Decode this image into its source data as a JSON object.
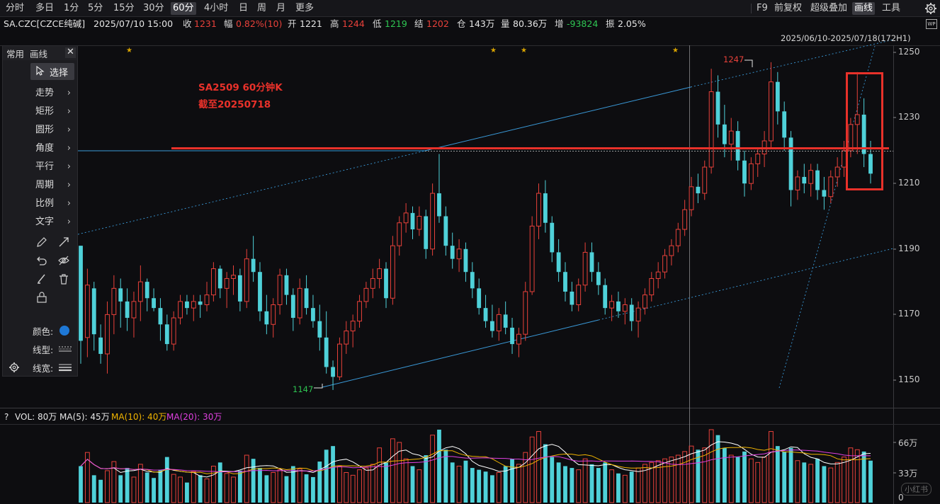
{
  "toolbar": {
    "periods": [
      "分时",
      "多日",
      "1分",
      "5分",
      "15分",
      "30分",
      "60分",
      "4小时",
      "日",
      "周",
      "月",
      "更多"
    ],
    "active_period": "60分",
    "right_buttons": [
      "F9",
      "前复权",
      "超级叠加",
      "画线",
      "工具"
    ],
    "active_right": "画线"
  },
  "info": {
    "symbol": "SA.CZC[CZCE纯碱]",
    "datetime": "2025/07/10 15:00",
    "close_label": "收",
    "close": "1231",
    "amp_label": "幅",
    "amp": "0.82%(10)",
    "open_label": "开",
    "open": "1221",
    "high_label": "高",
    "high": "1244",
    "low_label": "低",
    "low": "1219",
    "settle_label": "结",
    "settle": "1202",
    "oi_label": "仓",
    "oi": "143万",
    "vol_label": "量",
    "vol": "80.36万",
    "oichg_label": "增",
    "oichg": "-93824",
    "swing_label": "振",
    "swing": "2.05%",
    "wp": "WP"
  },
  "range_label": "2025/06/10-2025/07/18(172H1)",
  "drawbar": {
    "tab_common": "常用",
    "tab_draw": "画线",
    "close": "✕",
    "select": "选择",
    "items": [
      "走势",
      "矩形",
      "圆形",
      "角度",
      "平行",
      "周期",
      "比例",
      "文字"
    ],
    "color_label": "颜色:",
    "line_type_label": "线型:",
    "line_width_label": "线宽:"
  },
  "annotations": {
    "title": "SA2509 60分钟K",
    "subtitle": "截至20250718",
    "high_mark": "1247",
    "low_mark": "1147"
  },
  "colors": {
    "up": "#e8413a",
    "down": "#4fd1d9",
    "annotation_red": "#e8312a",
    "trendline": "#3a9ad9",
    "ma5": "#ffffff",
    "ma10": "#f0b400",
    "ma20": "#e040e0"
  },
  "volume": {
    "qmark": "?",
    "vol_text": "VOL: 80万",
    "ma5_text": "MA(5): 45万",
    "ma10_text": "MA(10): 40万",
    "ma20_text": "MA(20): 30万",
    "ticks": [
      "66万",
      "33万",
      "0"
    ]
  },
  "watermark": "小红书",
  "chart_data": {
    "type": "candlestick",
    "ylim": [
      1143,
      1252
    ],
    "yticks": [
      1250,
      1230,
      1210,
      1190,
      1170,
      1150
    ],
    "horizontal_level": 1220,
    "marked_high": 1247,
    "marked_low": 1147,
    "candles": [
      [
        1191,
        1191,
        1155,
        1162
      ],
      [
        1163,
        1184,
        1157,
        1179
      ],
      [
        1178,
        1180,
        1159,
        1164
      ],
      [
        1163,
        1167,
        1155,
        1158
      ],
      [
        1158,
        1174,
        1152,
        1170
      ],
      [
        1170,
        1182,
        1164,
        1178
      ],
      [
        1178,
        1181,
        1166,
        1174
      ],
      [
        1174,
        1178,
        1165,
        1169
      ],
      [
        1169,
        1177,
        1163,
        1174
      ],
      [
        1174,
        1185,
        1168,
        1180
      ],
      [
        1180,
        1181,
        1171,
        1175
      ],
      [
        1175,
        1178,
        1171,
        1172
      ],
      [
        1172,
        1175,
        1162,
        1167
      ],
      [
        1167,
        1170,
        1159,
        1161
      ],
      [
        1161,
        1171,
        1159,
        1169
      ],
      [
        1169,
        1176,
        1167,
        1174
      ],
      [
        1174,
        1176,
        1170,
        1172
      ],
      [
        1172,
        1176,
        1168,
        1174
      ],
      [
        1174,
        1176,
        1169,
        1173
      ],
      [
        1173,
        1180,
        1171,
        1176
      ],
      [
        1176,
        1186,
        1174,
        1184
      ],
      [
        1184,
        1185,
        1175,
        1178
      ],
      [
        1178,
        1183,
        1172,
        1181
      ],
      [
        1181,
        1185,
        1176,
        1182
      ],
      [
        1182,
        1184,
        1171,
        1174
      ],
      [
        1174,
        1190,
        1172,
        1187
      ],
      [
        1187,
        1194,
        1180,
        1183
      ],
      [
        1183,
        1186,
        1168,
        1171
      ],
      [
        1171,
        1176,
        1164,
        1167
      ],
      [
        1167,
        1175,
        1163,
        1173
      ],
      [
        1173,
        1184,
        1170,
        1182
      ],
      [
        1182,
        1184,
        1173,
        1176
      ],
      [
        1176,
        1178,
        1165,
        1169
      ],
      [
        1169,
        1181,
        1167,
        1178
      ],
      [
        1178,
        1182,
        1170,
        1172
      ],
      [
        1172,
        1176,
        1166,
        1168
      ],
      [
        1168,
        1173,
        1159,
        1163
      ],
      [
        1163,
        1171,
        1152,
        1154
      ],
      [
        1154,
        1156,
        1147,
        1151
      ],
      [
        1151,
        1163,
        1150,
        1161
      ],
      [
        1161,
        1168,
        1158,
        1165
      ],
      [
        1165,
        1170,
        1160,
        1168
      ],
      [
        1168,
        1176,
        1166,
        1174
      ],
      [
        1174,
        1180,
        1172,
        1178
      ],
      [
        1178,
        1184,
        1175,
        1181
      ],
      [
        1181,
        1187,
        1178,
        1184
      ],
      [
        1184,
        1186,
        1172,
        1175
      ],
      [
        1175,
        1194,
        1173,
        1191
      ],
      [
        1191,
        1200,
        1188,
        1198
      ],
      [
        1198,
        1204,
        1195,
        1201
      ],
      [
        1201,
        1203,
        1193,
        1196
      ],
      [
        1196,
        1203,
        1194,
        1200
      ],
      [
        1200,
        1202,
        1187,
        1190
      ],
      [
        1190,
        1210,
        1188,
        1207
      ],
      [
        1207,
        1219,
        1198,
        1200
      ],
      [
        1200,
        1203,
        1188,
        1191
      ],
      [
        1191,
        1195,
        1184,
        1187
      ],
      [
        1187,
        1193,
        1183,
        1190
      ],
      [
        1190,
        1192,
        1180,
        1183
      ],
      [
        1183,
        1186,
        1175,
        1178
      ],
      [
        1178,
        1181,
        1170,
        1172
      ],
      [
        1172,
        1176,
        1166,
        1168
      ],
      [
        1168,
        1173,
        1163,
        1165
      ],
      [
        1165,
        1172,
        1162,
        1170
      ],
      [
        1170,
        1174,
        1164,
        1166
      ],
      [
        1166,
        1169,
        1158,
        1161
      ],
      [
        1161,
        1166,
        1157,
        1164
      ],
      [
        1164,
        1180,
        1162,
        1177
      ],
      [
        1177,
        1200,
        1176,
        1197
      ],
      [
        1197,
        1210,
        1193,
        1207
      ],
      [
        1207,
        1211,
        1195,
        1198
      ],
      [
        1198,
        1200,
        1186,
        1189
      ],
      [
        1189,
        1193,
        1180,
        1183
      ],
      [
        1183,
        1186,
        1174,
        1177
      ],
      [
        1177,
        1180,
        1171,
        1173
      ],
      [
        1173,
        1181,
        1171,
        1179
      ],
      [
        1179,
        1192,
        1177,
        1189
      ],
      [
        1189,
        1192,
        1180,
        1183
      ],
      [
        1183,
        1186,
        1176,
        1179
      ],
      [
        1179,
        1181,
        1170,
        1172
      ],
      [
        1172,
        1176,
        1168,
        1174
      ],
      [
        1174,
        1177,
        1169,
        1171
      ],
      [
        1171,
        1175,
        1167,
        1173
      ],
      [
        1173,
        1175,
        1165,
        1168
      ],
      [
        1168,
        1174,
        1163,
        1172
      ],
      [
        1172,
        1178,
        1170,
        1176
      ],
      [
        1176,
        1183,
        1174,
        1181
      ],
      [
        1181,
        1186,
        1178,
        1183
      ],
      [
        1183,
        1190,
        1181,
        1188
      ],
      [
        1188,
        1193,
        1185,
        1191
      ],
      [
        1191,
        1198,
        1189,
        1196
      ],
      [
        1196,
        1205,
        1194,
        1202
      ],
      [
        1202,
        1212,
        1200,
        1209
      ],
      [
        1209,
        1213,
        1204,
        1207
      ],
      [
        1207,
        1217,
        1205,
        1215
      ],
      [
        1215,
        1245,
        1213,
        1238
      ],
      [
        1238,
        1243,
        1224,
        1228
      ],
      [
        1228,
        1234,
        1218,
        1222
      ],
      [
        1222,
        1230,
        1217,
        1226
      ],
      [
        1226,
        1229,
        1214,
        1217
      ],
      [
        1217,
        1220,
        1206,
        1210
      ],
      [
        1210,
        1218,
        1208,
        1216
      ],
      [
        1216,
        1221,
        1212,
        1219
      ],
      [
        1219,
        1226,
        1215,
        1223
      ],
      [
        1223,
        1247,
        1221,
        1241
      ],
      [
        1241,
        1244,
        1228,
        1232
      ],
      [
        1232,
        1235,
        1220,
        1224
      ],
      [
        1224,
        1226,
        1203,
        1208
      ],
      [
        1208,
        1214,
        1205,
        1212
      ],
      [
        1212,
        1216,
        1207,
        1210
      ],
      [
        1210,
        1216,
        1206,
        1214
      ],
      [
        1214,
        1216,
        1205,
        1208
      ],
      [
        1208,
        1212,
        1202,
        1206
      ],
      [
        1206,
        1214,
        1204,
        1212
      ],
      [
        1212,
        1218,
        1209,
        1215
      ],
      [
        1215,
        1223,
        1212,
        1220
      ],
      [
        1220,
        1230,
        1218,
        1228
      ],
      [
        1228,
        1244,
        1219,
        1231
      ],
      [
        1231,
        1236,
        1215,
        1219
      ],
      [
        1219,
        1223,
        1210,
        1213
      ]
    ],
    "volumes": [
      40,
      55,
      30,
      25,
      35,
      45,
      30,
      38,
      28,
      42,
      33,
      27,
      36,
      50,
      31,
      28,
      22,
      34,
      30,
      26,
      40,
      44,
      32,
      28,
      35,
      52,
      48,
      38,
      30,
      33,
      36,
      29,
      40,
      37,
      31,
      28,
      45,
      58,
      62,
      40,
      33,
      30,
      36,
      38,
      42,
      60,
      44,
      70,
      66,
      48,
      40,
      36,
      52,
      74,
      80,
      58,
      44,
      40,
      46,
      38,
      36,
      34,
      30,
      33,
      40,
      48,
      42,
      55,
      72,
      78,
      64,
      50,
      44,
      40,
      38,
      36,
      48,
      42,
      38,
      44,
      36,
      32,
      30,
      34,
      38,
      42,
      44,
      46,
      48,
      50,
      52,
      56,
      62,
      58,
      60,
      80,
      74,
      60,
      52,
      50,
      56,
      48,
      44,
      50,
      78,
      62,
      56,
      60,
      46,
      44,
      42,
      48,
      40,
      38,
      44,
      50,
      60,
      58,
      56,
      46
    ]
  }
}
